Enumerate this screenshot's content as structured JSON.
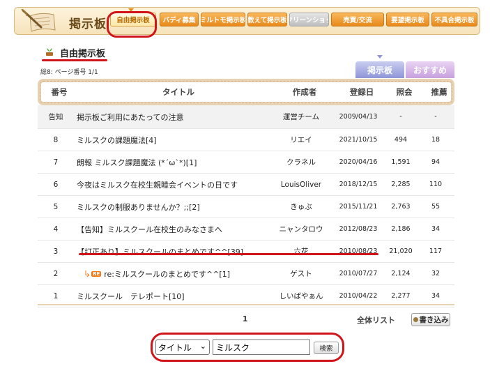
{
  "header": {
    "board_title": "掲示板",
    "tabs": [
      {
        "label": "自由掲示板",
        "style": "active"
      },
      {
        "label": "バディ募集",
        "style": "orange"
      },
      {
        "label": "ミルトモ掲示板",
        "style": "orange"
      },
      {
        "label": "教えて掲示板",
        "style": "orange"
      },
      {
        "label": "スクリーンショット",
        "style": "gray"
      },
      {
        "label": "売買/交流",
        "style": "orange"
      },
      {
        "label": "要望掲示板",
        "style": "orange"
      },
      {
        "label": "不具合掲示板",
        "style": "orange"
      }
    ]
  },
  "section": {
    "title": "自由掲示板",
    "page_info": "総8: ページ番号 1/1",
    "tabs": {
      "board": "掲示板",
      "recommend": "おすすめ"
    }
  },
  "table": {
    "headers": {
      "num": "番号",
      "title": "タイトル",
      "author": "作成者",
      "date": "登録日",
      "views": "照会",
      "rec": "推薦"
    },
    "rows": [
      {
        "num": "告知",
        "title": "掲示板ご利用にあたっての注意",
        "author": "運営チーム",
        "date": "2009/04/13",
        "views": "-",
        "rec": "-",
        "notice": true
      },
      {
        "num": "8",
        "title": "ミルスクの課題魔法[4]",
        "author": "リエイ",
        "date": "2021/10/15",
        "views": "494",
        "rec": "18"
      },
      {
        "num": "7",
        "title": "朗報 ミルスク課題魔法 (*´ω`*)[1]",
        "author": "クラネル",
        "date": "2020/04/16",
        "views": "1,591",
        "rec": "94"
      },
      {
        "num": "6",
        "title": "今夜はミルスク在校生親睦会イベントの日です",
        "author": "LouisOliver",
        "date": "2018/12/15",
        "views": "2,285",
        "rec": "110"
      },
      {
        "num": "5",
        "title": "ミルスクの制服ありませんか？;;[2]",
        "author": "きゅぶ",
        "date": "2015/11/21",
        "views": "2,763",
        "rec": "55"
      },
      {
        "num": "4",
        "title": "【告知】ミルスクール在校生のみなさまへ",
        "author": "ニャンタロウ",
        "date": "2012/08/23",
        "views": "2,186",
        "rec": "34"
      },
      {
        "num": "3",
        "title": "【訂正あり】ミルスクールのまとめです^^[39]",
        "author": "六花",
        "date": "2010/08/23",
        "views": "21,020",
        "rec": "117"
      },
      {
        "num": "2",
        "title": "re:ミルスクールのまとめです^^[1]",
        "author": "ゲスト",
        "date": "2010/07/27",
        "views": "2,124",
        "rec": "32",
        "reply": true,
        "reply_badge": "RE"
      },
      {
        "num": "1",
        "title": "ミルスクール　テレポート[10]",
        "author": "しいばやぁん",
        "date": "2010/04/22",
        "views": "2,277",
        "rec": "34"
      }
    ]
  },
  "footer": {
    "page": "1",
    "list_all": "全体リスト",
    "write": "書き込み"
  },
  "search": {
    "field_selected": "タイトル",
    "query": "ミルスク",
    "button": "検索"
  },
  "colors": {
    "highlight_red": "#d0141a",
    "tab_orange": "#e8891c",
    "table_border": "#e8d2b4"
  }
}
